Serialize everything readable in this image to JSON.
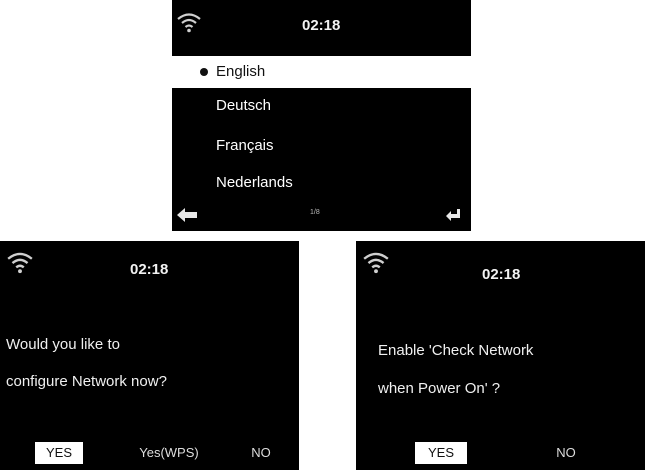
{
  "screen1": {
    "time": "02:18",
    "languages": [
      {
        "label": "English",
        "selected": true
      },
      {
        "label": "Deutsch",
        "selected": false
      },
      {
        "label": "Français",
        "selected": false
      },
      {
        "label": "Nederlands",
        "selected": false
      }
    ],
    "page_indicator": "1/8",
    "icons": [
      "wifi-icon",
      "back-arrow-icon",
      "enter-icon"
    ]
  },
  "screen2": {
    "time": "02:18",
    "message_line1": "Would you like to",
    "message_line2": "configure Network now?",
    "buttons": {
      "yes": "YES",
      "yes_wps": "Yes(WPS)",
      "no": "NO"
    },
    "selected_button": "YES"
  },
  "screen3": {
    "time": "02:18",
    "message_line1": "Enable 'Check Network",
    "message_line2": "when Power On' ?",
    "buttons": {
      "yes": "YES",
      "no": "NO"
    },
    "selected_button": "YES"
  },
  "colors": {
    "screen_bg": "#000000",
    "highlight": "#ffffff",
    "text": "#ffffff"
  }
}
